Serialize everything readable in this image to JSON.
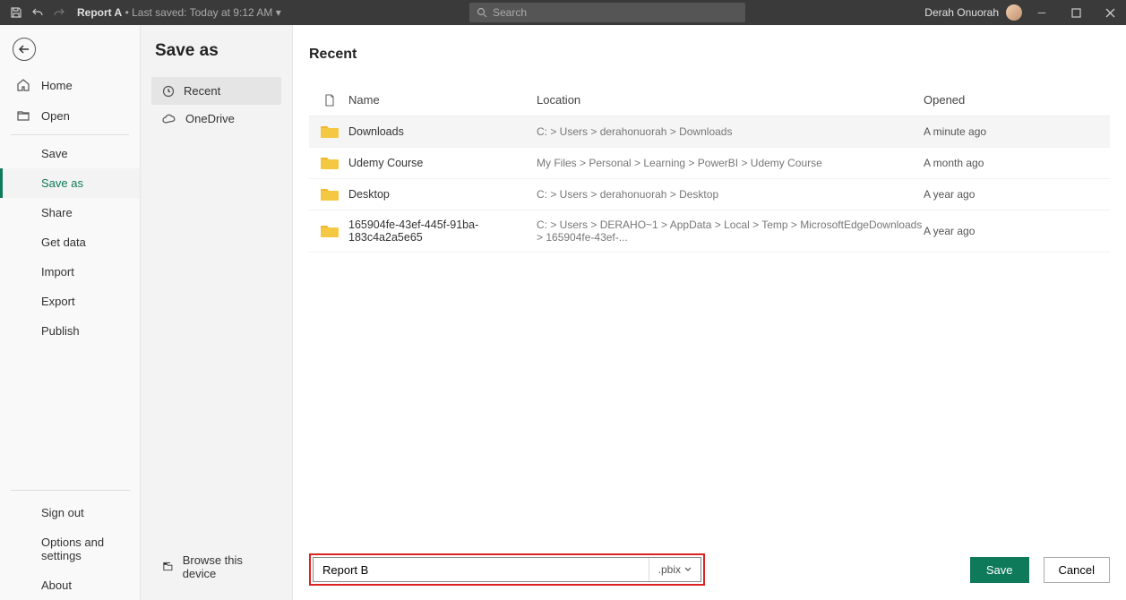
{
  "titlebar": {
    "report_name": "Report A",
    "save_status": "Last saved: Today at 9:12 AM",
    "search_placeholder": "Search",
    "user_name": "Derah Onuorah"
  },
  "sidebar1": {
    "home": "Home",
    "open": "Open",
    "save": "Save",
    "save_as": "Save as",
    "share": "Share",
    "get_data": "Get data",
    "import": "Import",
    "export": "Export",
    "publish": "Publish",
    "sign_out": "Sign out",
    "options": "Options and settings",
    "about": "About"
  },
  "sidebar2": {
    "title": "Save as",
    "recent": "Recent",
    "onedrive": "OneDrive",
    "browse": "Browse this device"
  },
  "content": {
    "heading": "Recent",
    "col_name": "Name",
    "col_location": "Location",
    "col_opened": "Opened",
    "rows": [
      {
        "name": "Downloads",
        "location": "C: > Users > derahonuorah > Downloads",
        "opened": "A minute ago"
      },
      {
        "name": "Udemy Course",
        "location": "My Files > Personal > Learning > PowerBI > Udemy Course",
        "opened": "A month ago"
      },
      {
        "name": "Desktop",
        "location": "C: > Users > derahonuorah > Desktop",
        "opened": "A year ago"
      },
      {
        "name": "165904fe-43ef-445f-91ba-183c4a2a5e65",
        "location": "C: > Users > DERAHO~1 > AppData > Local > Temp > MicrosoftEdgeDownloads > 165904fe-43ef-...",
        "opened": "A year ago"
      }
    ]
  },
  "footer": {
    "filename": "Report B",
    "filetype": ".pbix",
    "save": "Save",
    "cancel": "Cancel"
  }
}
